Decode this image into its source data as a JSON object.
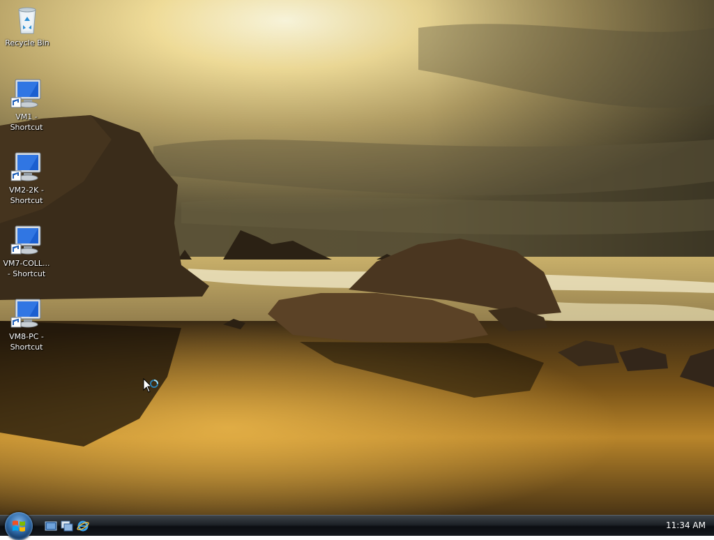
{
  "desktop": {
    "icons": [
      {
        "label": "Recycle Bin",
        "icon": "recycle-bin-icon"
      },
      {
        "label": "VM1 -\nShortcut",
        "icon": "computer-shortcut-icon"
      },
      {
        "label": "VM2-2K -\nShortcut",
        "icon": "computer-shortcut-icon"
      },
      {
        "label": "VM7-COLL...\n- Shortcut",
        "icon": "computer-shortcut-icon"
      },
      {
        "label": "VM8-PC -\nShortcut",
        "icon": "computer-shortcut-icon"
      }
    ]
  },
  "taskbar": {
    "start_icon": "windows-start-orb-icon",
    "quick_launch": [
      {
        "icon": "show-desktop-icon"
      },
      {
        "icon": "switch-windows-icon"
      },
      {
        "icon": "internet-explorer-icon"
      }
    ],
    "clock": "11:34 AM"
  },
  "colors": {
    "sky_light": "#f4e6a8",
    "sky_dark": "#6e6448",
    "rock": "#3b2f1e",
    "taskbar": "#14181c"
  }
}
